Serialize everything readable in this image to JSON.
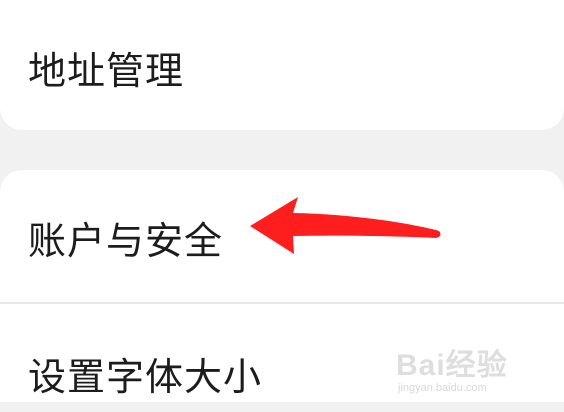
{
  "menu": {
    "items": [
      {
        "label": "地址管理"
      },
      {
        "label": "账户与安全"
      },
      {
        "label": "设置字体大小"
      }
    ]
  },
  "annotation": {
    "arrow_icon": "left-arrow-icon",
    "color": "#ff1e1e"
  },
  "watermark": {
    "main": "Bai经验",
    "sub": "jingyan.baidu.com"
  },
  "colors": {
    "background": "#f1f1f1",
    "card": "#ffffff",
    "text": "#1c1c1c"
  }
}
